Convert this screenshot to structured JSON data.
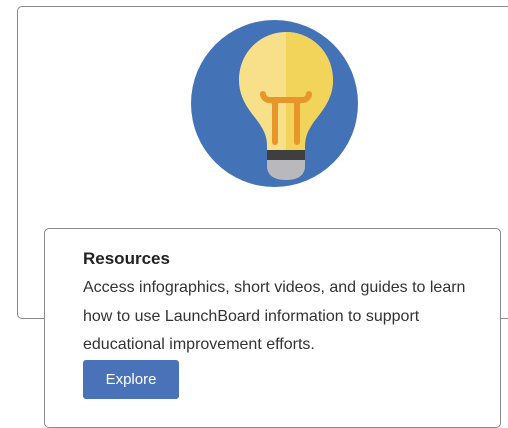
{
  "card": {
    "icon": "lightbulb-icon",
    "circle_color": "#4472b7"
  },
  "resources": {
    "title": "Resources",
    "description": "Access infographics, short videos, and guides to learn how to use LaunchBoard information to support educational improvement efforts.",
    "button_label": "Explore",
    "button_color": "#4a72b8"
  }
}
